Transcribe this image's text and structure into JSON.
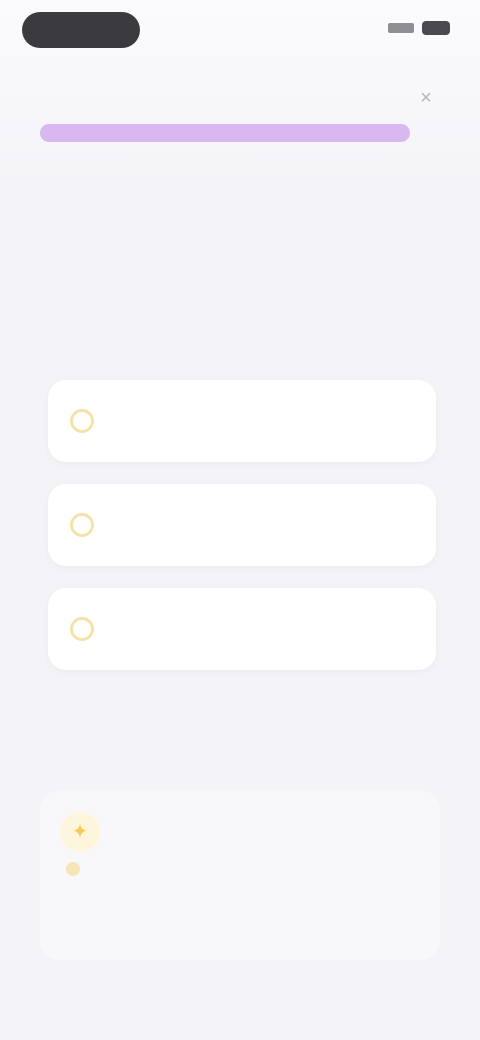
{
  "colors": {
    "background": "#f4f4f8",
    "progress_track": "#eadcf6",
    "progress_fill": "#d9b8f1",
    "card": "#ffffff",
    "radio_accent": "#f4e2a8"
  },
  "header": {
    "title": "",
    "close_icon": "close-icon"
  },
  "progress": {
    "fraction": 1.0
  },
  "question": {
    "text": ""
  },
  "options": [
    {
      "label": ""
    },
    {
      "label": ""
    },
    {
      "label": ""
    }
  ],
  "footer": {
    "icon": "lightbulb-icon",
    "text": ""
  }
}
